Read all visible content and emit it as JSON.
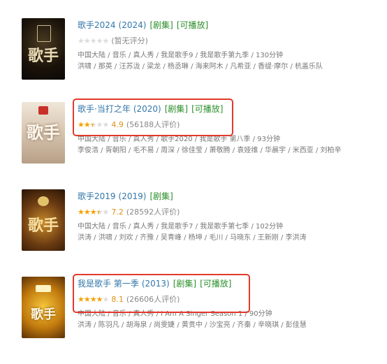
{
  "items": [
    {
      "title": "歌手2024",
      "year": "(2024)",
      "tag_series": "[剧集]",
      "tag_play": "[可播放]",
      "stars_on": 0,
      "score": "",
      "votes": "(暂无评分)",
      "meta": "中国大陆 / 音乐 / 真人秀 / 我是歌手9 / 我是歌手第九季 / 130分钟",
      "cast": "洪啸 / 那英 / 汪苏泷 / 梁龙 / 杨丞琳 / 海来阿木 / 凡希亚 / 香缇·摩尔 / 杭盖乐队",
      "poster_text": "歌手",
      "highlighted": false
    },
    {
      "title": "歌手·当打之年",
      "year": "(2020)",
      "tag_series": "[剧集]",
      "tag_play": "[可播放]",
      "stars_on": 2.5,
      "score": "4.9",
      "votes": "(56188人评价)",
      "meta": "中国大陆 / 音乐 / 真人秀 / 歌手2020 / 我是歌手 第八季 / 93分钟",
      "cast": "李俊浩 / 胥朝阳 / 毛不易 / 周深 / 徐佳莹 / 萧敬腾 / 袁娅维 / 华晨宇 / 米西亚 / 刘柏辛",
      "poster_text": "歌手",
      "highlighted": true
    },
    {
      "title": "歌手2019",
      "year": "(2019)",
      "tag_series": "[剧集]",
      "tag_play": "",
      "stars_on": 3.5,
      "score": "7.2",
      "votes": "(28592人评价)",
      "meta": "中国大陆 / 音乐 / 真人秀 / 我是歌手7 / 我是歌手第七季 / 102分钟",
      "cast": "洪涛 / 洪啸 / 刘欢 / 齐豫 / 吴青峰 / 杨坤 / 毛川 / 马晓东 / 王新刚 / 李洪涛",
      "poster_text": "歌手",
      "highlighted": false
    },
    {
      "title": "我是歌手 第一季",
      "year": "(2013)",
      "tag_series": "[剧集]",
      "tag_play": "[可播放]",
      "stars_on": 4,
      "score": "8.1",
      "votes": "(26606人评价)",
      "meta": "中国大陆 / 音乐 / 真人秀 / I Am A Singer Season 1 / 90分钟",
      "cast": "洪涛 / 陈羽凡 / 胡海泉 / 尚雯婕 / 黄贵中 / 沙宝亮 / 齐秦 / 辛晓琪 / 彭佳慧",
      "poster_text": "歌手",
      "highlighted": true
    }
  ],
  "colors": {
    "link": "#3377aa",
    "tag": "#2a8e2a",
    "star": "#f4a100",
    "highlight": "#e23a2b"
  }
}
